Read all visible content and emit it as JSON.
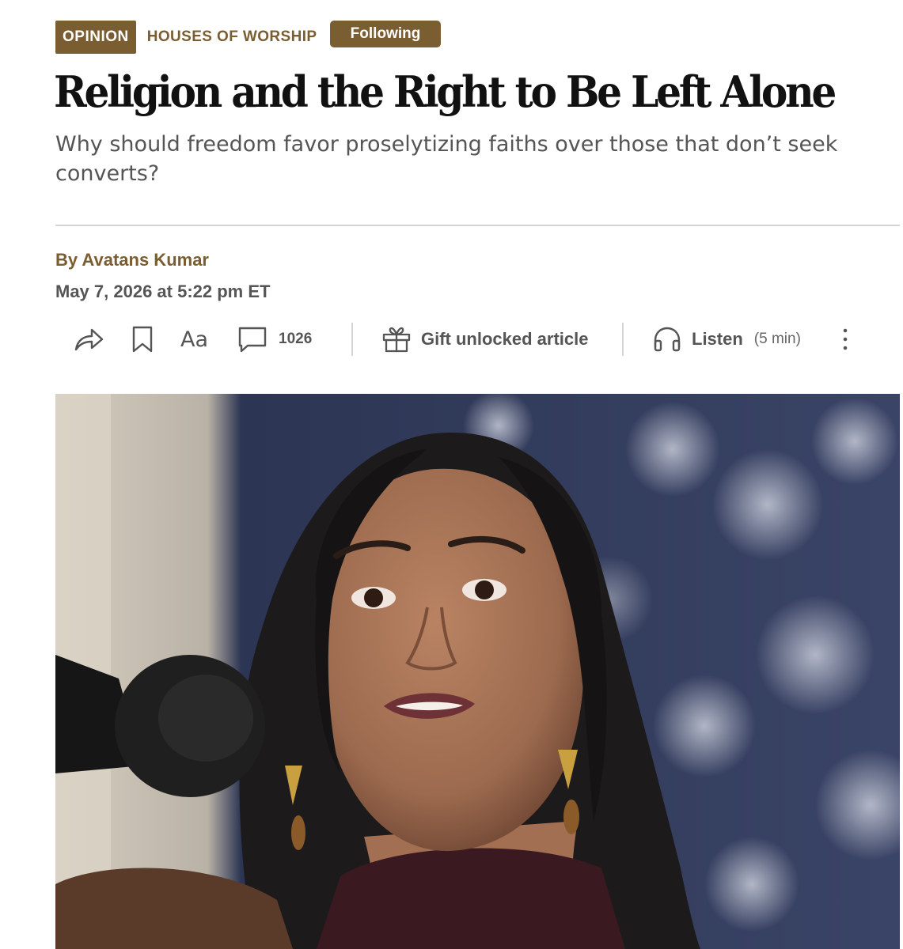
{
  "article": {
    "section_badge": "OPINION",
    "section_name": "HOUSES OF WORSHIP",
    "follow_label": "Following",
    "headline": "Religion and the Right to Be Left Alone",
    "dek": "Why should freedom favor proselytizing faiths over those that don’t seek converts?",
    "byline_prefix": "By",
    "author": "Avatans Kumar",
    "dateline": "May 7, 2026 at 5:22 pm ET"
  },
  "toolbar": {
    "share_icon": "share-icon",
    "bookmark_icon": "bookmark-icon",
    "text_size_label": "Aa",
    "comment_count": "1026",
    "gift_label": "Gift unlocked article",
    "listen_label": "Listen",
    "listen_duration": "(5 min)",
    "more_icon": "more-vertical-icon"
  },
  "colors": {
    "accent": "#7b5d32",
    "text_muted": "#555555",
    "rule": "#d6d6d6"
  }
}
